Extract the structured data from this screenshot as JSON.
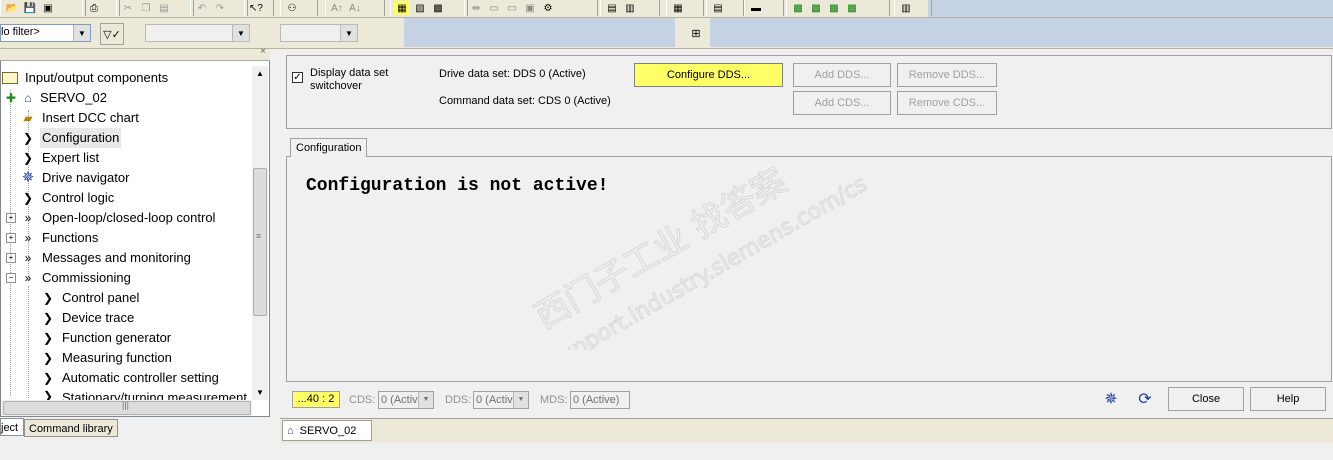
{
  "toolbar": {
    "filter_value": "lo filter>",
    "filter_icon": "filter-funnel-icon"
  },
  "tree": {
    "items": [
      {
        "label": "Input/output components",
        "icon": "folder-icon"
      },
      {
        "label": "SERVO_02",
        "icon": "drive-icon"
      },
      {
        "label": "Insert DCC chart",
        "icon": "insert-chart-icon"
      },
      {
        "label": "Configuration",
        "icon": "chevron-right-icon"
      },
      {
        "label": "Expert list",
        "icon": "chevron-right-icon"
      },
      {
        "label": "Drive navigator",
        "icon": "gear-icon"
      },
      {
        "label": "Control logic",
        "icon": "chevron-right-icon"
      },
      {
        "label": "Open-loop/closed-loop control",
        "icon": "double-chevron-icon"
      },
      {
        "label": "Functions",
        "icon": "double-chevron-icon"
      },
      {
        "label": "Messages and monitoring",
        "icon": "double-chevron-icon"
      },
      {
        "label": "Commissioning",
        "icon": "double-chevron-icon"
      },
      {
        "label": "Control panel",
        "icon": "chevron-right-icon"
      },
      {
        "label": "Device trace",
        "icon": "chevron-right-icon"
      },
      {
        "label": "Function generator",
        "icon": "chevron-right-icon"
      },
      {
        "label": "Measuring function",
        "icon": "chevron-right-icon"
      },
      {
        "label": "Automatic controller setting",
        "icon": "chevron-right-icon"
      },
      {
        "label": "Stationary/turning measurement",
        "icon": "chevron-right-icon"
      }
    ],
    "tabs": [
      "ject",
      "Command library"
    ]
  },
  "top_panel": {
    "display_switchover_label_1": "Display data set",
    "display_switchover_label_2": "switchover",
    "display_switchover_checked": true,
    "drive_data_set": "Drive data set: DDS 0 (Active)",
    "command_data_set": "Command data set: CDS 0 (Active)",
    "configure_dds": "Configure DDS...",
    "add_dds": "Add DDS...",
    "remove_dds": "Remove DDS...",
    "add_cds": "Add CDS...",
    "remove_cds": "Remove CDS..."
  },
  "config_tab": {
    "label": "Configuration",
    "message": "Configuration is not active!"
  },
  "watermark": {
    "line1": "西门子工业  找答案",
    "line2": "support.industry.siemens.com/cs"
  },
  "status_bar": {
    "address": "...40 : 2",
    "cds_label": "CDS:",
    "cds_value": "0 (Activ",
    "dds_label": "DDS:",
    "dds_value": "0 (Activ",
    "mds_label": "MDS:",
    "mds_value": "0 (Active)",
    "close": "Close",
    "help": "Help"
  },
  "bottom_tabs": {
    "servo": "SERVO_02"
  },
  "colors": {
    "yellow": "#ffff66",
    "toolbar_blue": "#c4d2e3"
  }
}
